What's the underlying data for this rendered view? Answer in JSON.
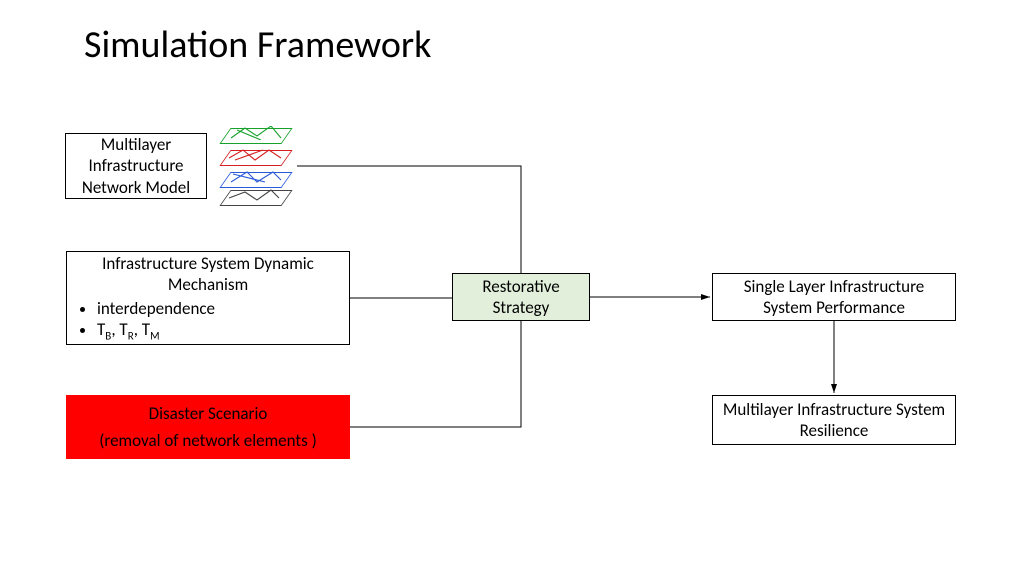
{
  "title": "Simulation Framework",
  "boxes": {
    "multilayer_model": "Multilayer Infrastructure Network Model",
    "dynamic_mechanism": {
      "heading": "Infrastructure System Dynamic Mechanism",
      "bullet1": "interdependence",
      "bullet2_html": "T_B, T_R, T_M"
    },
    "disaster": {
      "line1": "Disaster Scenario",
      "line2": "(removal of network elements )"
    },
    "restorative": "Restorative Strategy",
    "single_layer_perf": "Single Layer Infrastructure System Performance",
    "multilayer_resilience": "Multilayer Infrastructure System Resilience"
  },
  "relations": [
    {
      "from": "multilayer_model",
      "to": "restorative",
      "type": "line"
    },
    {
      "from": "dynamic_mechanism",
      "to": "restorative",
      "type": "line"
    },
    {
      "from": "disaster",
      "to": "restorative",
      "type": "line"
    },
    {
      "from": "restorative",
      "to": "single_layer_perf",
      "type": "arrow"
    },
    {
      "from": "single_layer_perf",
      "to": "multilayer_resilience",
      "type": "arrow"
    }
  ]
}
